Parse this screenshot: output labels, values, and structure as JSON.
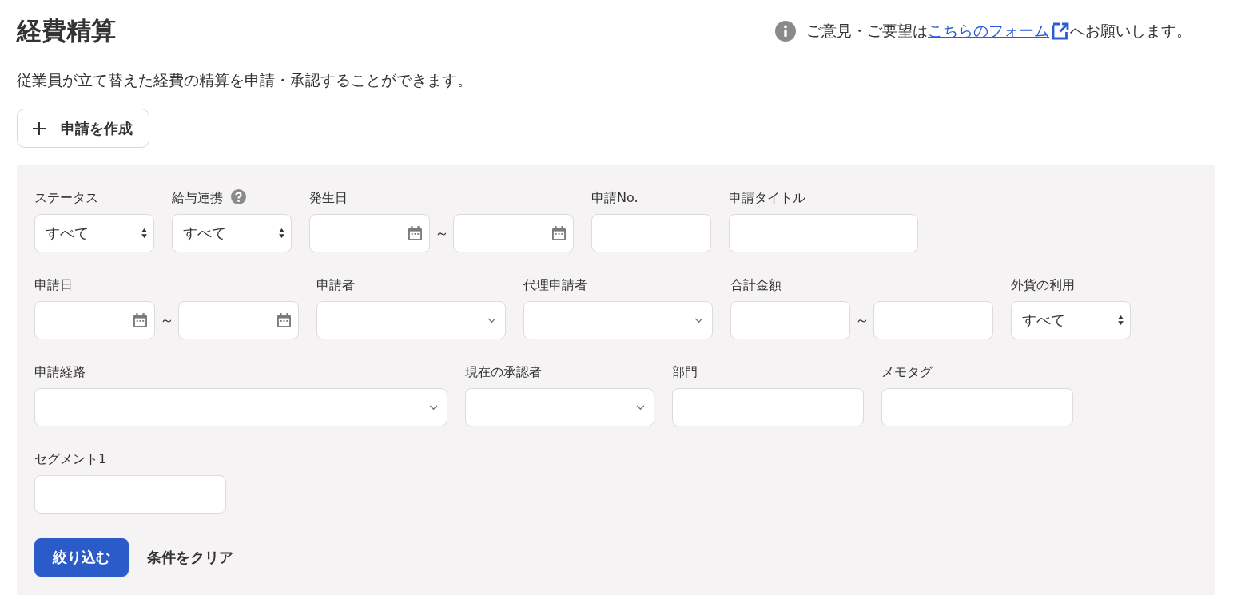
{
  "header": {
    "title": "経費精算",
    "feedback": {
      "before": "ご意見・ご要望は",
      "link": "こちらのフォーム",
      "after": "へお願いします。"
    }
  },
  "description": "従業員が立て替えた経費の精算を申請・承認することができます。",
  "create_button": {
    "label": "申請を作成"
  },
  "filters": {
    "rows": [
      {
        "fields": [
          {
            "label": "ステータス",
            "help": false,
            "kind": "select",
            "value": "すべて"
          },
          {
            "label": "給与連携",
            "help": true,
            "kind": "select",
            "value": "すべて"
          },
          {
            "label": "発生日",
            "help": false,
            "kind": "date_range",
            "separator": "～"
          },
          {
            "label": "申請No.",
            "help": false,
            "kind": "text"
          },
          {
            "label": "申請タイトル",
            "help": false,
            "kind": "text"
          }
        ]
      },
      {
        "fields": [
          {
            "label": "申請日",
            "help": false,
            "kind": "date_range",
            "separator": "～"
          },
          {
            "label": "申請者",
            "help": false,
            "kind": "combo"
          },
          {
            "label": "代理申請者",
            "help": false,
            "kind": "combo"
          },
          {
            "label": "合計金額",
            "help": false,
            "kind": "text_range",
            "separator": "～"
          },
          {
            "label": "外貨の利用",
            "help": false,
            "kind": "select",
            "value": "すべて"
          }
        ]
      },
      {
        "fields": [
          {
            "label": "申請経路",
            "help": false,
            "kind": "combo"
          },
          {
            "label": "現在の承認者",
            "help": false,
            "kind": "combo"
          },
          {
            "label": "部門",
            "help": false,
            "kind": "text"
          },
          {
            "label": "メモタグ",
            "help": false,
            "kind": "text"
          }
        ]
      },
      {
        "fields": [
          {
            "label": "セグメント1",
            "help": false,
            "kind": "text"
          }
        ]
      }
    ]
  },
  "actions": {
    "apply_button": "絞り込む",
    "clear_link": "条件をクリア"
  }
}
